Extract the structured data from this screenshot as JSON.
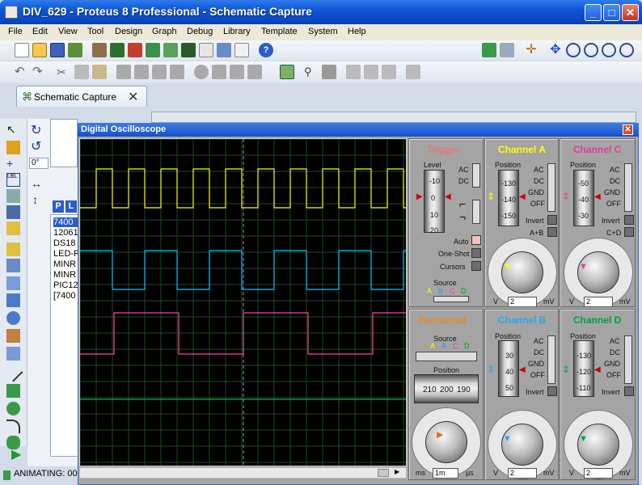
{
  "window": {
    "title": "DIV_629 - Proteus 8 Professional - Schematic Capture"
  },
  "menu": [
    "File",
    "Edit",
    "View",
    "Tool",
    "Design",
    "Graph",
    "Debug",
    "Library",
    "Template",
    "System",
    "Help"
  ],
  "tab": {
    "label": "Schematic Capture"
  },
  "angle": "0°",
  "device_list": {
    "header_p": "P",
    "header_l": "L",
    "items": [
      "7400",
      "12061",
      "DS18",
      "LED-R",
      "MINR",
      "MINR",
      "PIC12",
      "[7400"
    ]
  },
  "status": {
    "text": "ANIMATING: 00"
  },
  "oscilloscope": {
    "title": "Digital Oscilloscope",
    "trigger": {
      "title": "Trigger",
      "level_label": "Level",
      "level_ticks": [
        "-10",
        "0",
        "10",
        "20"
      ],
      "ac": "AC",
      "dc": "DC",
      "auto": "Auto",
      "one_shot": "One-Shot",
      "cursors": "Cursors",
      "source_label": "Source",
      "sources": [
        "A",
        "B",
        "C",
        "D"
      ]
    },
    "horizontal": {
      "title": "Horizontal",
      "source_label": "Source",
      "sources": [
        "A",
        "B",
        "C",
        "D"
      ],
      "position_label": "Position",
      "position_ticks": [
        "210",
        "200",
        "190"
      ],
      "knob_field": "1m",
      "unit_left": "ms",
      "unit_right": "µs",
      "knob_scale": [
        "0.5",
        "1",
        "2",
        "5",
        "10",
        "20",
        "50",
        "100",
        "200",
        "0.5",
        "1",
        "2",
        "5",
        "10",
        "20",
        "50",
        "100",
        "200"
      ]
    },
    "channel_a": {
      "title": "Channel A",
      "position_label": "Position",
      "ticks": [
        "-130",
        "-140",
        "-150"
      ],
      "ac": "AC",
      "dc": "DC",
      "gnd": "GND",
      "off": "OFF",
      "invert": "Invert",
      "combo": "A+B",
      "field": "2",
      "unit_left": "V",
      "unit_right": "mV",
      "color": "#ffff00"
    },
    "channel_b": {
      "title": "Channel B",
      "position_label": "Position",
      "ticks": [
        "30",
        "40",
        "50"
      ],
      "ac": "AC",
      "dc": "DC",
      "gnd": "GND",
      "off": "OFF",
      "invert": "Invert",
      "field": "2",
      "unit_left": "V",
      "unit_right": "mV",
      "color": "#00c8ff"
    },
    "channel_c": {
      "title": "Channel C",
      "position_label": "Position",
      "ticks": [
        "-50",
        "-40",
        "-30"
      ],
      "ac": "AC",
      "dc": "DC",
      "gnd": "GND",
      "off": "OFF",
      "invert": "Invert",
      "combo": "C+D",
      "field": "2",
      "unit_left": "V",
      "unit_right": "mV",
      "color": "#ff3fb0"
    },
    "channel_d": {
      "title": "Channel D",
      "position_label": "Position",
      "ticks": [
        "-130",
        "-120",
        "-110"
      ],
      "ac": "AC",
      "dc": "DC",
      "gnd": "GND",
      "off": "OFF",
      "invert": "Invert",
      "field": "2",
      "unit_left": "V",
      "unit_right": "mV",
      "color": "#00b050"
    },
    "knob_scale_volts": [
      "0.5",
      "1",
      "2",
      "5",
      "10",
      "20",
      "50",
      "100",
      "200"
    ],
    "knob_scale_mv": [
      "0.5",
      "1",
      "2",
      "5",
      "10",
      "20"
    ],
    "trace_colors": {
      "a": "#ffff00",
      "b": "#00c8ff",
      "c": "#ff3fb0",
      "d": "#00b050"
    }
  }
}
